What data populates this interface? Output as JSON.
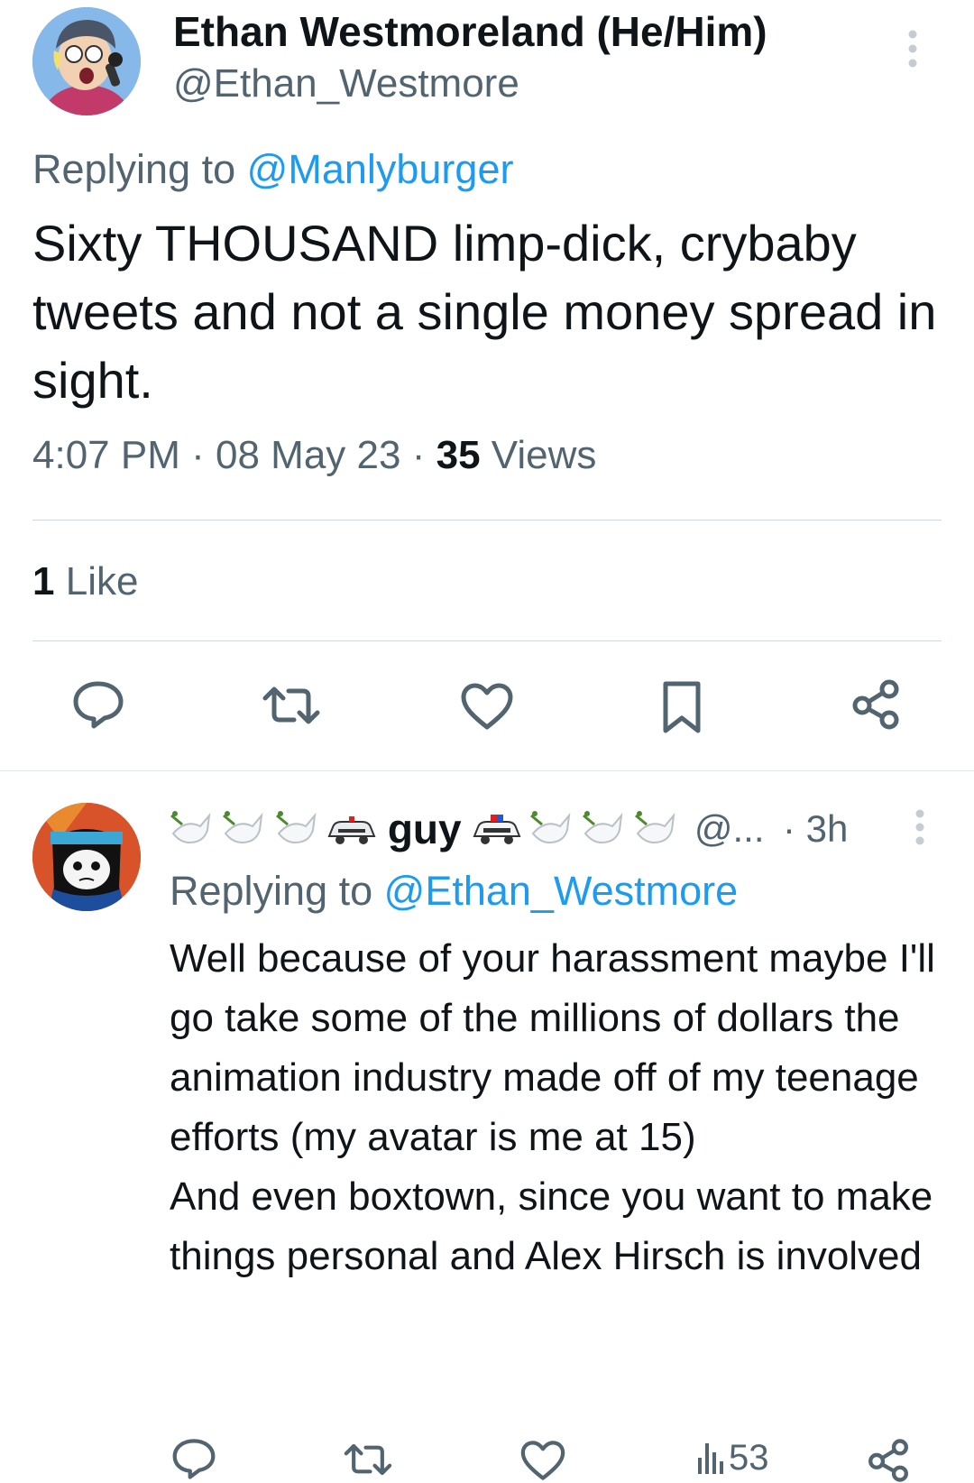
{
  "main_tweet": {
    "author_name": "Ethan Westmoreland (He/Him)",
    "author_handle": "@Ethan_Westmore",
    "replying_prefix": "Replying to",
    "replying_to": "@Manlyburger",
    "text": "Sixty THOUSAND limp-dick, crybaby tweets and not a single money spread in sight.",
    "time": "4:07 PM",
    "date": "08 May 23",
    "separator": "·",
    "views_count": "35",
    "views_label": "Views",
    "likes_count": "1",
    "likes_label": "Like",
    "actions": [
      "reply-icon",
      "retweet-icon",
      "like-icon",
      "bookmark-icon",
      "share-icon"
    ]
  },
  "reply_tweet": {
    "author_name": "guy",
    "name_emoji_left": [
      "dove",
      "dove",
      "dove",
      "police-car"
    ],
    "name_emoji_right": [
      "police-car",
      "dove",
      "dove",
      "dove"
    ],
    "author_handle": "@...",
    "time": "· 3h",
    "replying_prefix": "Replying to",
    "replying_to": "@Ethan_Westmore",
    "text_lines": [
      "Well because of your harassment maybe I'll go take some of the millions of dollars the animation industry made off of my teenage efforts (my avatar is me at 15)",
      "And even boxtown, since you want to make things personal and Alex Hirsch is involved"
    ],
    "views_count": "53",
    "actions": [
      "reply-icon",
      "retweet-icon",
      "like-icon",
      "views-icon",
      "share-icon"
    ]
  },
  "colors": {
    "text_primary": "#0f1419",
    "text_secondary": "#536471",
    "link": "#1d9bf0",
    "divider": "#cfd9de"
  }
}
